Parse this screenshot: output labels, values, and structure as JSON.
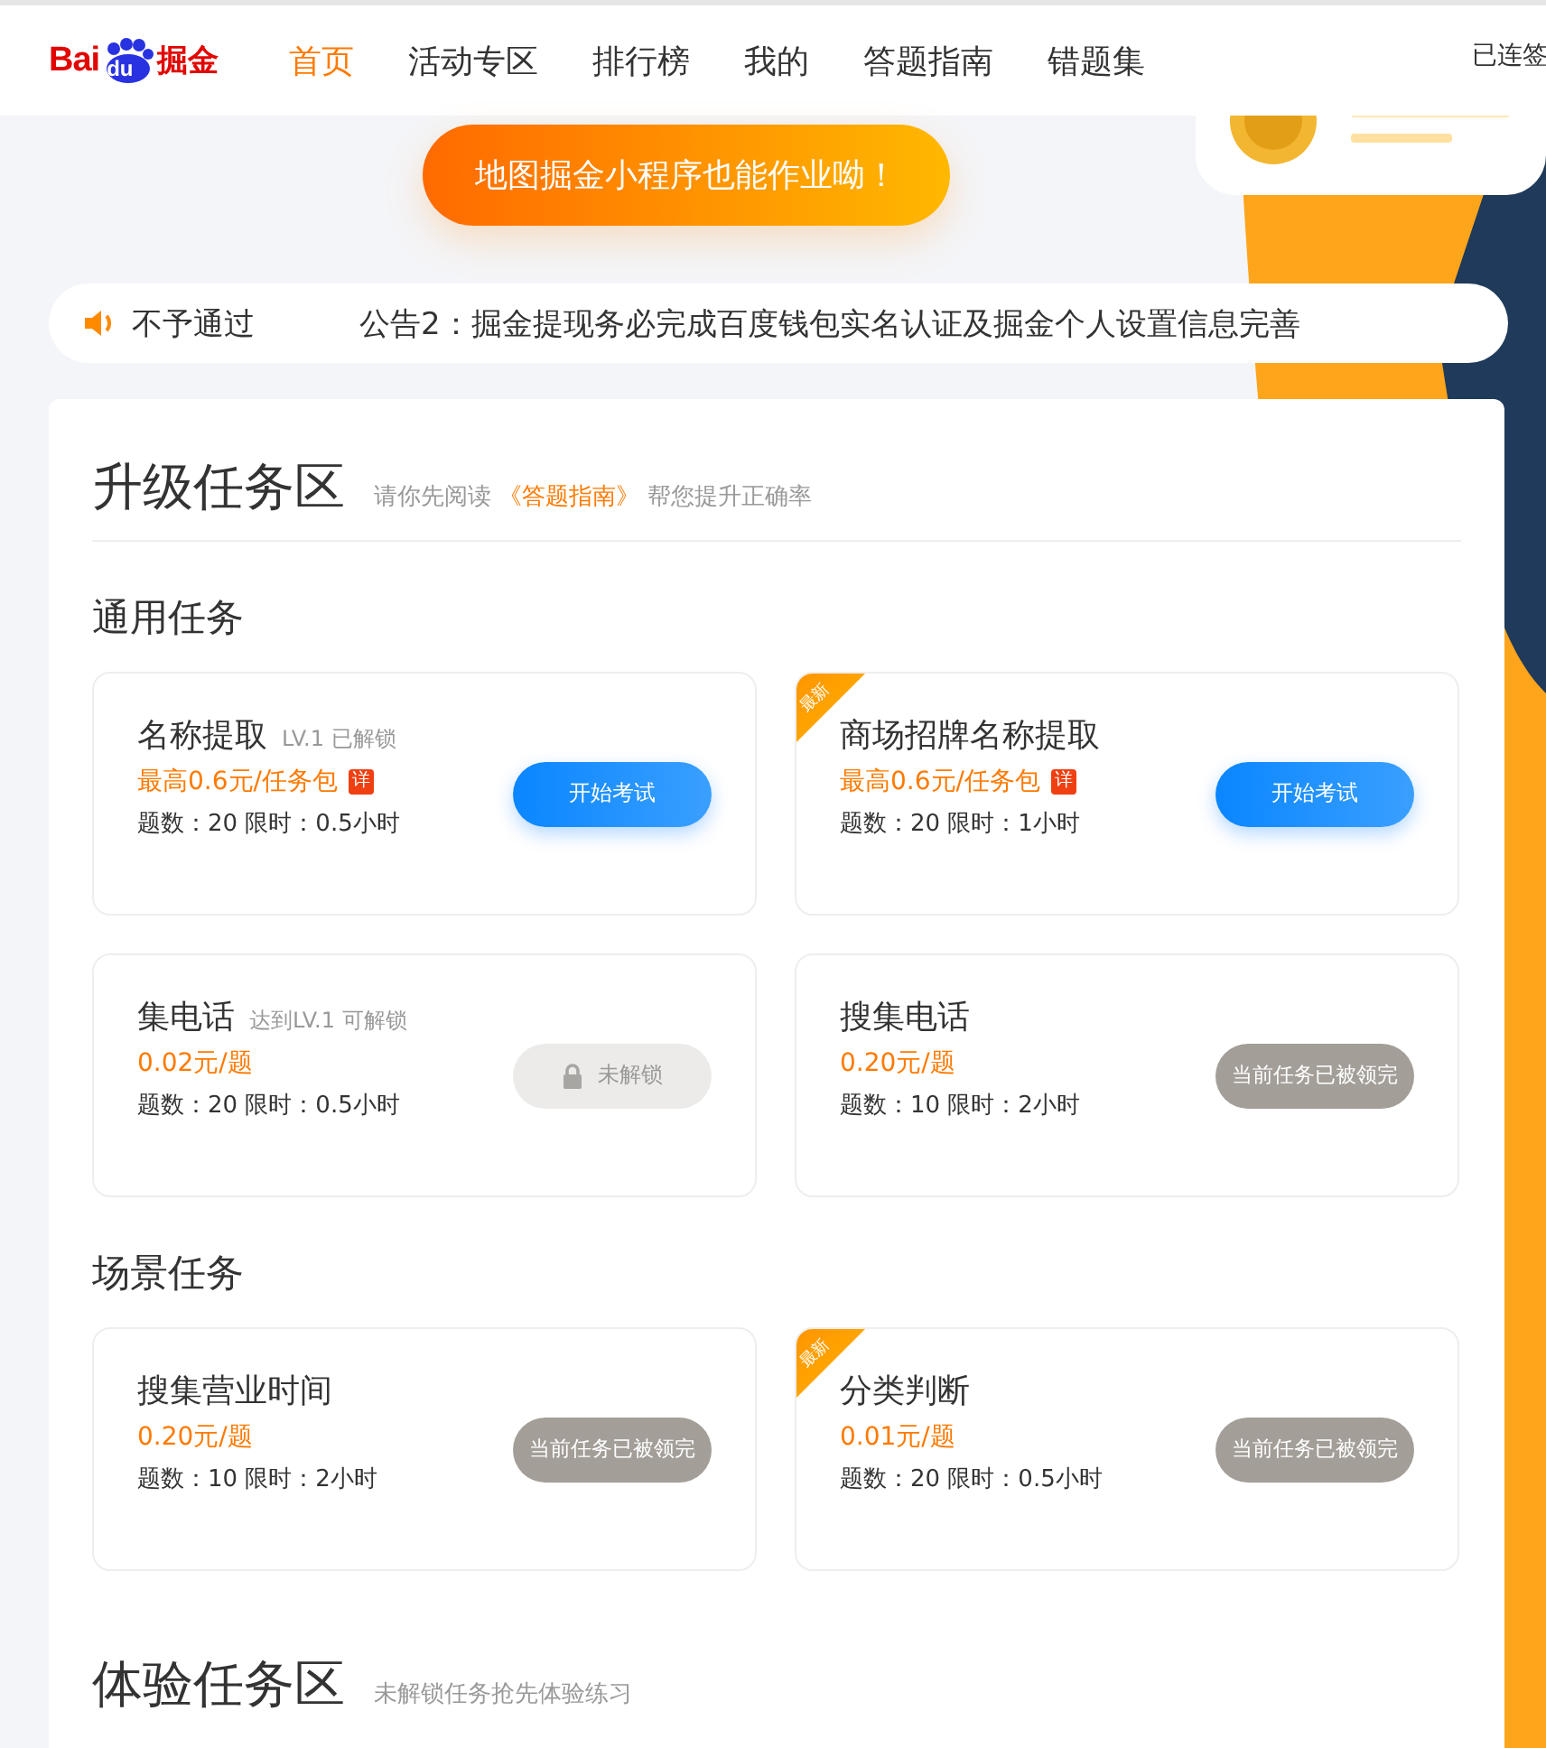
{
  "header": {
    "logo": {
      "left": "Bai",
      "paw": "du",
      "right": "掘金"
    },
    "nav": [
      {
        "label": "首页",
        "selected": true
      },
      {
        "label": "活动专区",
        "selected": false
      },
      {
        "label": "排行榜",
        "selected": false
      },
      {
        "label": "我的",
        "selected": false
      },
      {
        "label": "答题指南",
        "selected": false
      },
      {
        "label": "错题集",
        "selected": false
      }
    ],
    "checkin": "已连签"
  },
  "banner": {
    "label": "地图掘金小程序也能作业呦！"
  },
  "notice": {
    "items": [
      "不予通过",
      "公告2：掘金提现务必完成百度钱包实名认证及掘金个人设置信息完善"
    ]
  },
  "sections": [
    {
      "title": "升级任务区",
      "hint": "请你先阅读 **《答题指南》** 帮您提升正确率",
      "groups": [
        {
          "title": "通用任务",
          "tasks": [
            {
              "title": "名称提取",
              "tag": "LV.1 已解锁",
              "price": "最高0.6元/任务包",
              "detail": "详",
              "info": "题数：20 限时：0.5小时",
              "action": {
                "kind": "start",
                "label": "开始考试"
              }
            },
            {
              "title": "商场招牌名称提取",
              "price": "最高0.6元/任务包",
              "detail": "详",
              "info": "题数：20 限时：1小时",
              "ribbon": "最新",
              "action": {
                "kind": "start",
                "label": "开始考试"
              }
            },
            {
              "title": "集电话",
              "tag": "达到LV.1 可解锁",
              "price": "0.02元/题",
              "info": "题数：20 限时：0.5小时",
              "action": {
                "kind": "locked",
                "label": "未解锁"
              }
            },
            {
              "title": "搜集电话",
              "price": "0.20元/题",
              "info": "题数：10 限时：2小时",
              "action": {
                "kind": "taken",
                "label": "当前任务已被领完"
              }
            }
          ]
        },
        {
          "title": "场景任务",
          "tasks": [
            {
              "title": "搜集营业时间",
              "price": "0.20元/题",
              "info": "题数：10 限时：2小时",
              "action": {
                "kind": "taken",
                "label": "当前任务已被领完"
              }
            },
            {
              "title": "分类判断",
              "price": "0.01元/题",
              "info": "题数：20 限时：0.5小时",
              "ribbon": "最新",
              "action": {
                "kind": "taken",
                "label": "当前任务已被领完"
              }
            }
          ]
        }
      ]
    },
    {
      "title": "体验任务区",
      "hint": "未解锁任务抢先体验练习"
    }
  ]
}
